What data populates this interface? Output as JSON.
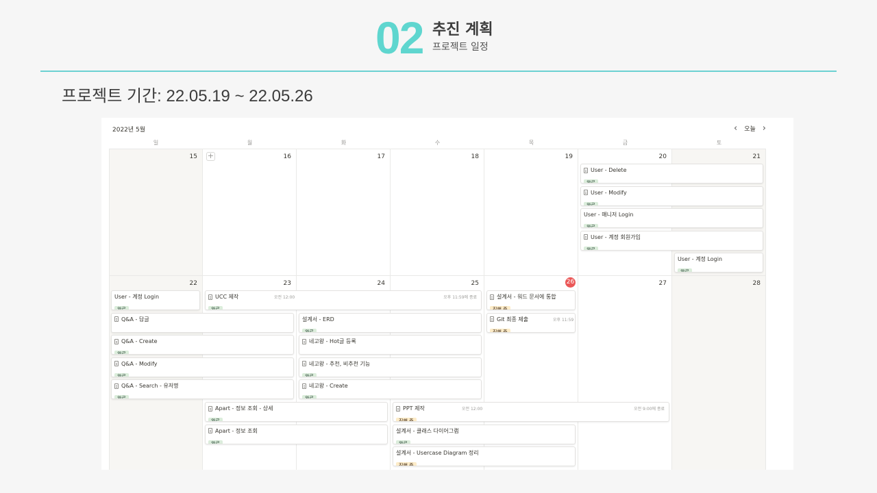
{
  "slide": {
    "number": "02",
    "title": "추진 계획",
    "subtitle": "프로젝트 일정",
    "period": "프로젝트 기간: 22.05.19 ~ 22.05.26",
    "accent_color": "#5fd6cf"
  },
  "calendar": {
    "month_label": "2022년 5월",
    "today_label": "오늘",
    "prev_icon": "chevron-left-icon",
    "next_icon": "chevron-right-icon",
    "weekdays": [
      "일",
      "월",
      "화",
      "수",
      "목",
      "금",
      "토"
    ],
    "week1_days": [
      "15",
      "16",
      "17",
      "18",
      "19",
      "20",
      "21"
    ],
    "week2_days": [
      "22",
      "23",
      "24",
      "25",
      "26",
      "27",
      "28"
    ],
    "today": "26",
    "add_icon": "plus-icon",
    "status_colors": {
      "완료": "#dbeddb",
      "진행 중": "#fdecc8"
    },
    "events": [
      {
        "title": "User - Delete",
        "status": "완료",
        "doc_icon": true
      },
      {
        "title": "User - Modify",
        "status": "완료",
        "doc_icon": true
      },
      {
        "title": "User - 매니저 Login",
        "status": "완료",
        "doc_icon": false
      },
      {
        "title": "User - 계정 회원가입",
        "status": "완료",
        "doc_icon": true
      },
      {
        "title": "User - 계정 Login",
        "status": "완료",
        "doc_icon": false
      },
      {
        "title": "User - 계정 Login",
        "status": "완료",
        "doc_icon": false
      },
      {
        "title": "UCC 제작",
        "status": "완료",
        "doc_icon": true,
        "start_time": "오전 12:00",
        "end_time": "오후 11:59에 종료"
      },
      {
        "title": "설계서 - 워드 문서에 통합",
        "status": "진행 중",
        "doc_icon": true
      },
      {
        "title": "Q&A - 답글",
        "status": "",
        "doc_icon": true
      },
      {
        "title": "설계서 - ERD",
        "status": "완료",
        "doc_icon": false
      },
      {
        "title": "Git 최종 제출",
        "status": "진행 중",
        "doc_icon": true,
        "start_time": "오후 11:59"
      },
      {
        "title": "Q&A - Create",
        "status": "완료",
        "doc_icon": true
      },
      {
        "title": "네고왕 - Hot글 등록",
        "status": "",
        "doc_icon": true
      },
      {
        "title": "Q&A - Modify",
        "status": "완료",
        "doc_icon": true
      },
      {
        "title": "네고왕 - 추천, 비추천 기능",
        "status": "완료",
        "doc_icon": true
      },
      {
        "title": "Q&A - Search - 유저명",
        "status": "완료",
        "doc_icon": true
      },
      {
        "title": "네고왕 - Create",
        "status": "완료",
        "doc_icon": true
      },
      {
        "title": "Apart - 정보 조회 - 상세",
        "status": "완료",
        "doc_icon": true
      },
      {
        "title": "PPT 제작",
        "status": "진행 중",
        "doc_icon": true,
        "start_time": "오전 12:00",
        "end_time": "오전 9:00에 종료"
      },
      {
        "title": "Apart - 정보 조회",
        "status": "완료",
        "doc_icon": true
      },
      {
        "title": "설계서 - 클래스 다이어그램",
        "status": "완료",
        "doc_icon": false
      },
      {
        "title": "설계서 - Usercase Diagram 정리",
        "status": "진행 중",
        "doc_icon": false
      }
    ]
  }
}
